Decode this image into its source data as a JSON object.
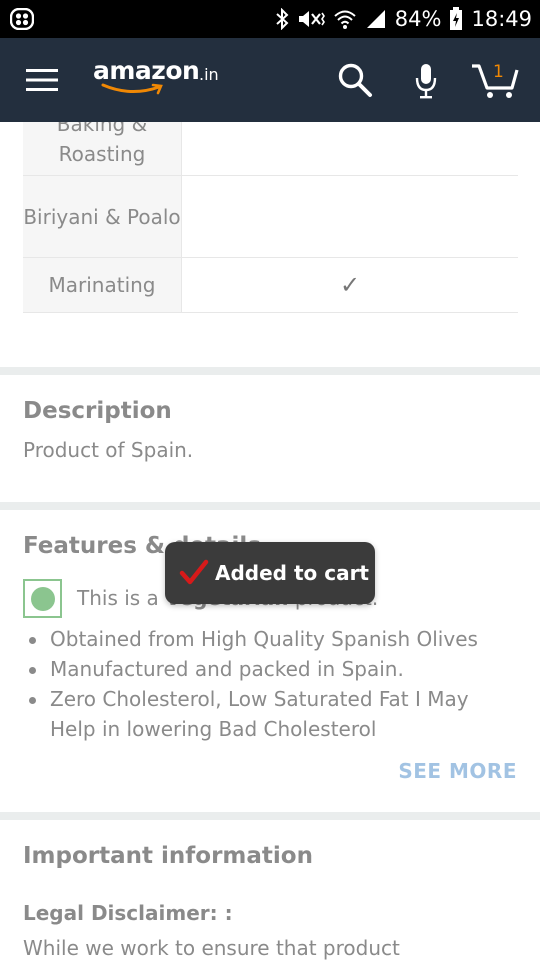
{
  "status_bar": {
    "battery": "84%",
    "time": "18:49"
  },
  "header": {
    "logo_main": "amazon",
    "logo_tld": ".in",
    "cart_count": "1",
    "colors": {
      "background": "#232f3e",
      "accent": "#f08804"
    }
  },
  "usage_table": {
    "rows": [
      {
        "name": "Baking & Roasting",
        "value": ""
      },
      {
        "name": "Biriyani & Poalo",
        "value": ""
      },
      {
        "name": "Marinating",
        "value": "✓"
      }
    ]
  },
  "description": {
    "title": "Description",
    "text": "Product of Spain."
  },
  "features": {
    "title": "Features & details",
    "veg_prefix": "This is a ",
    "veg_bold": "Vegetarian",
    "veg_suffix": " product.",
    "bullets": [
      "Obtained from High Quality Spanish Olives",
      "Manufactured and packed in Spain.",
      "Zero Cholesterol, Low Saturated Fat I May Help in lowering Bad Cholesterol"
    ],
    "see_more": "SEE MORE"
  },
  "important": {
    "title": "Important information",
    "legal_label": "Legal Disclaimer: :",
    "legal_text": "While we work to ensure that product"
  },
  "toast": {
    "text": "Added to cart"
  }
}
